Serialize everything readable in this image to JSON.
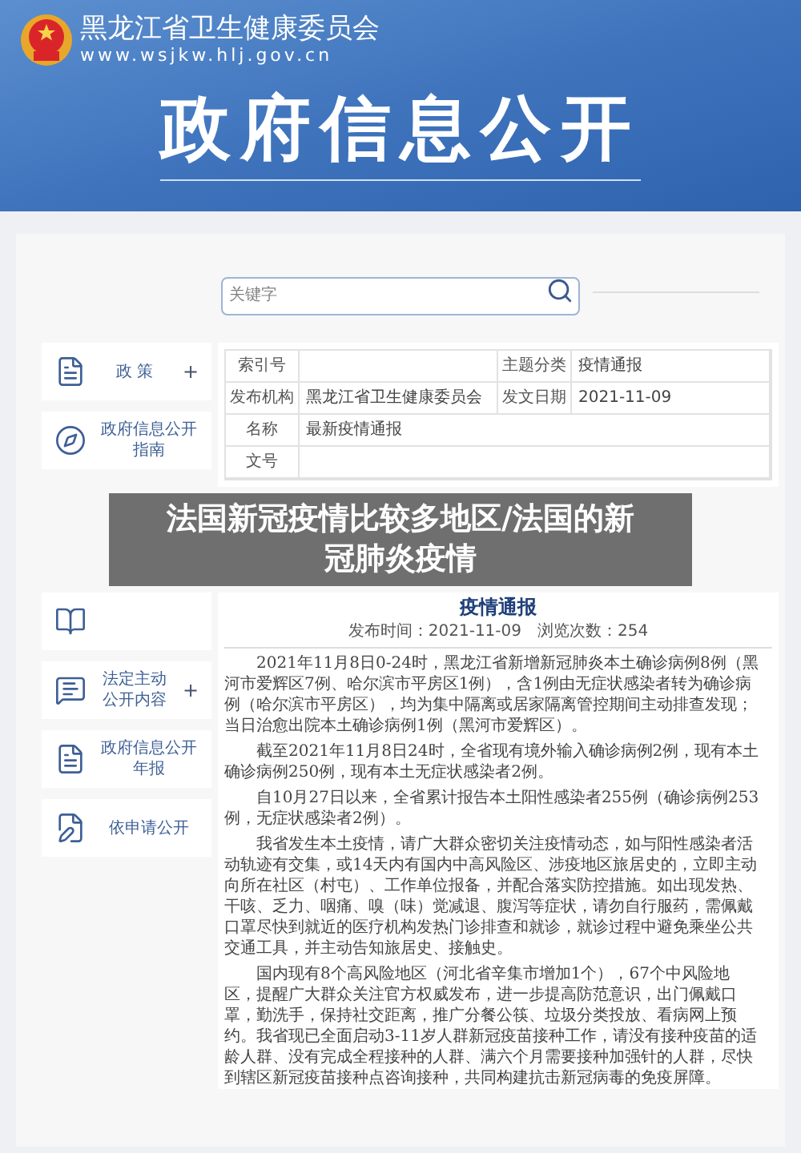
{
  "header": {
    "org_name": "黑龙江省卫生健康委员会",
    "url": "www.wsjkw.hlj.gov.cn",
    "banner_title": "政府信息公开"
  },
  "search": {
    "placeholder": "关键字"
  },
  "sidebar": {
    "items": [
      {
        "kind": "labeled",
        "label": "政 策",
        "toggle": "+"
      },
      {
        "kind": "labeled",
        "label": "政府信息公开指南"
      },
      {
        "kind": "icon_only"
      },
      {
        "kind": "labeled",
        "label": "法定主动公开内容",
        "toggle": "+"
      },
      {
        "kind": "labeled",
        "label": "政府信息公开年报"
      },
      {
        "kind": "labeled",
        "label": "依申请公开"
      }
    ]
  },
  "info_table": {
    "rows": [
      [
        {
          "label": "索引号"
        },
        {
          "label": "主题分类",
          "value": "疫情通报"
        }
      ],
      [
        {
          "label": "发布机构",
          "value": "黑龙江省卫生健康委员会"
        },
        {
          "label": "发文日期",
          "value": "2021-11-09"
        }
      ],
      [
        {
          "label": "名称",
          "value": "最新疫情通报"
        }
      ],
      [
        {
          "label": "文号"
        }
      ]
    ]
  },
  "article": {
    "title": "疫情通报",
    "meta": "发布时间：2021-11-09　浏览次数：254",
    "paragraphs": [
      "2021年11月8日0-24时，黑龙江省新增新冠肺炎本土确诊病例8例（黑河市爱辉区7例、哈尔滨市平房区1例），含1例由无症状感染者转为确诊病例（哈尔滨市平房区），均为集中隔离或居家隔离管控期间主动排查发现；当日治愈出院本土确诊病例1例（黑河市爱辉区）。",
      "截至2021年11月8日24时，全省现有境外输入确诊病例2例，现有本土确诊病例250例，现有本土无症状感染者2例。",
      "自10月27日以来，全省累计报告本土阳性感染者255例（确诊病例253例，无症状感染者2例）。",
      "我省发生本土疫情，请广大群众密切关注疫情动态，如与阳性感染者活动轨迹有交集，或14天内有国内中高风险区、涉疫地区旅居史的，立即主动向所在社区（村屯）、工作单位报备，并配合落实防控措施。如出现发热、干咳、乏力、咽痛、嗅（味）觉减退、腹泻等症状，请勿自行服药，需佩戴口罩尽快到就近的医疗机构发热门诊排查和就诊，就诊过程中避免乘坐公共交通工具，并主动告知旅居史、接触史。",
      "国内现有8个高风险地区（河北省辛集市增加1个），67个中风险地区，提醒广大群众关注官方权威发布，进一步提高防范意识，出门佩戴口罩，勤洗手，保持社交距离，推广分餐公筷、垃圾分类投放、看病网上预约。我省现已全面启动3-11岁人群新冠疫苗接种工作，请没有接种疫苗的适龄人群、没有完成全程接种的人群、满六个月需要接种加强针的人群，尽快到辖区新冠疫苗接种点咨询接种，共同构建抗击新冠病毒的免疫屏障。"
    ]
  },
  "caption": {
    "lines": [
      "法国新冠疫情比较多地区/法国的新",
      "冠肺炎疫情"
    ]
  }
}
